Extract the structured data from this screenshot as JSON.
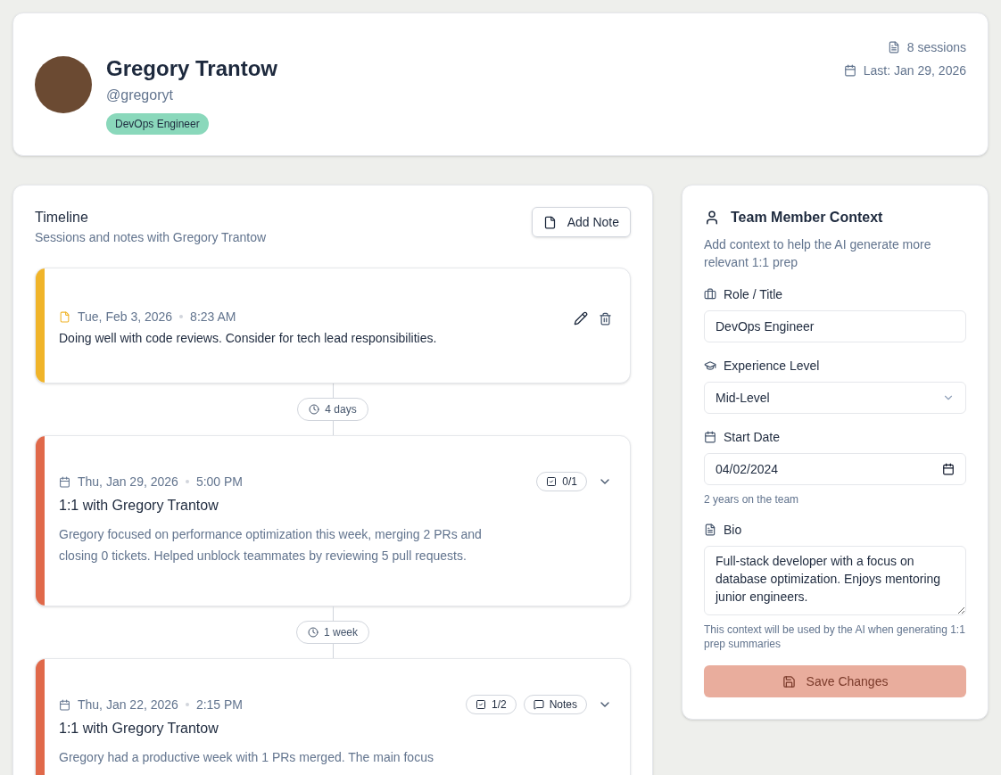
{
  "profile": {
    "name": "Gregory Trantow",
    "handle": "@gregoryt",
    "role_badge": "DevOps Engineer",
    "sessions": "8 sessions",
    "last": "Last: Jan 29, 2026"
  },
  "timeline": {
    "title": "Timeline",
    "subtitle": "Sessions and notes with Gregory Trantow",
    "add_button": "Add Note",
    "items": [
      {
        "kind": "note",
        "color": "#f0b429",
        "date": "Tue, Feb 3, 2026",
        "time": "8:23 AM",
        "text": "Doing well with code reviews. Consider for tech lead responsibilities."
      },
      {
        "kind": "gap",
        "label": "4 days"
      },
      {
        "kind": "session",
        "color": "#e0694a",
        "date": "Thu, Jan 29, 2026",
        "time": "5:00 PM",
        "title": "1:1 with Gregory Trantow",
        "tasks": "0/1",
        "text": "Gregory focused on performance optimization this week, merging 2 PRs and closing 0 tickets. Helped unblock teammates by reviewing 5 pull requests.",
        "expanded": false
      },
      {
        "kind": "gap",
        "label": "1 week"
      },
      {
        "kind": "session",
        "color": "#e0694a",
        "date": "Thu, Jan 22, 2026",
        "time": "2:15 PM",
        "title": "1:1 with Gregory Trantow",
        "tasks": "1/2",
        "notes": "Notes",
        "text": "Gregory had a productive week with 1 PRs merged. The main focus",
        "expanded": false
      }
    ]
  },
  "context": {
    "title": "Team Member Context",
    "description": "Add context to help the AI generate more relevant 1:1 prep",
    "role_label": "Role / Title",
    "role_value": "DevOps Engineer",
    "experience_label": "Experience Level",
    "experience_value": "Mid-Level",
    "start_label": "Start Date",
    "start_value": "04/02/2024",
    "start_hint": "2 years on the team",
    "bio_label": "Bio",
    "bio_value": "Full-stack developer with a focus on database optimization. Enjoys mentoring junior engineers.",
    "footnote": "This context will be used by the AI when generating 1:1 prep summaries",
    "save_button": "Save Changes",
    "save_disabled": true
  }
}
